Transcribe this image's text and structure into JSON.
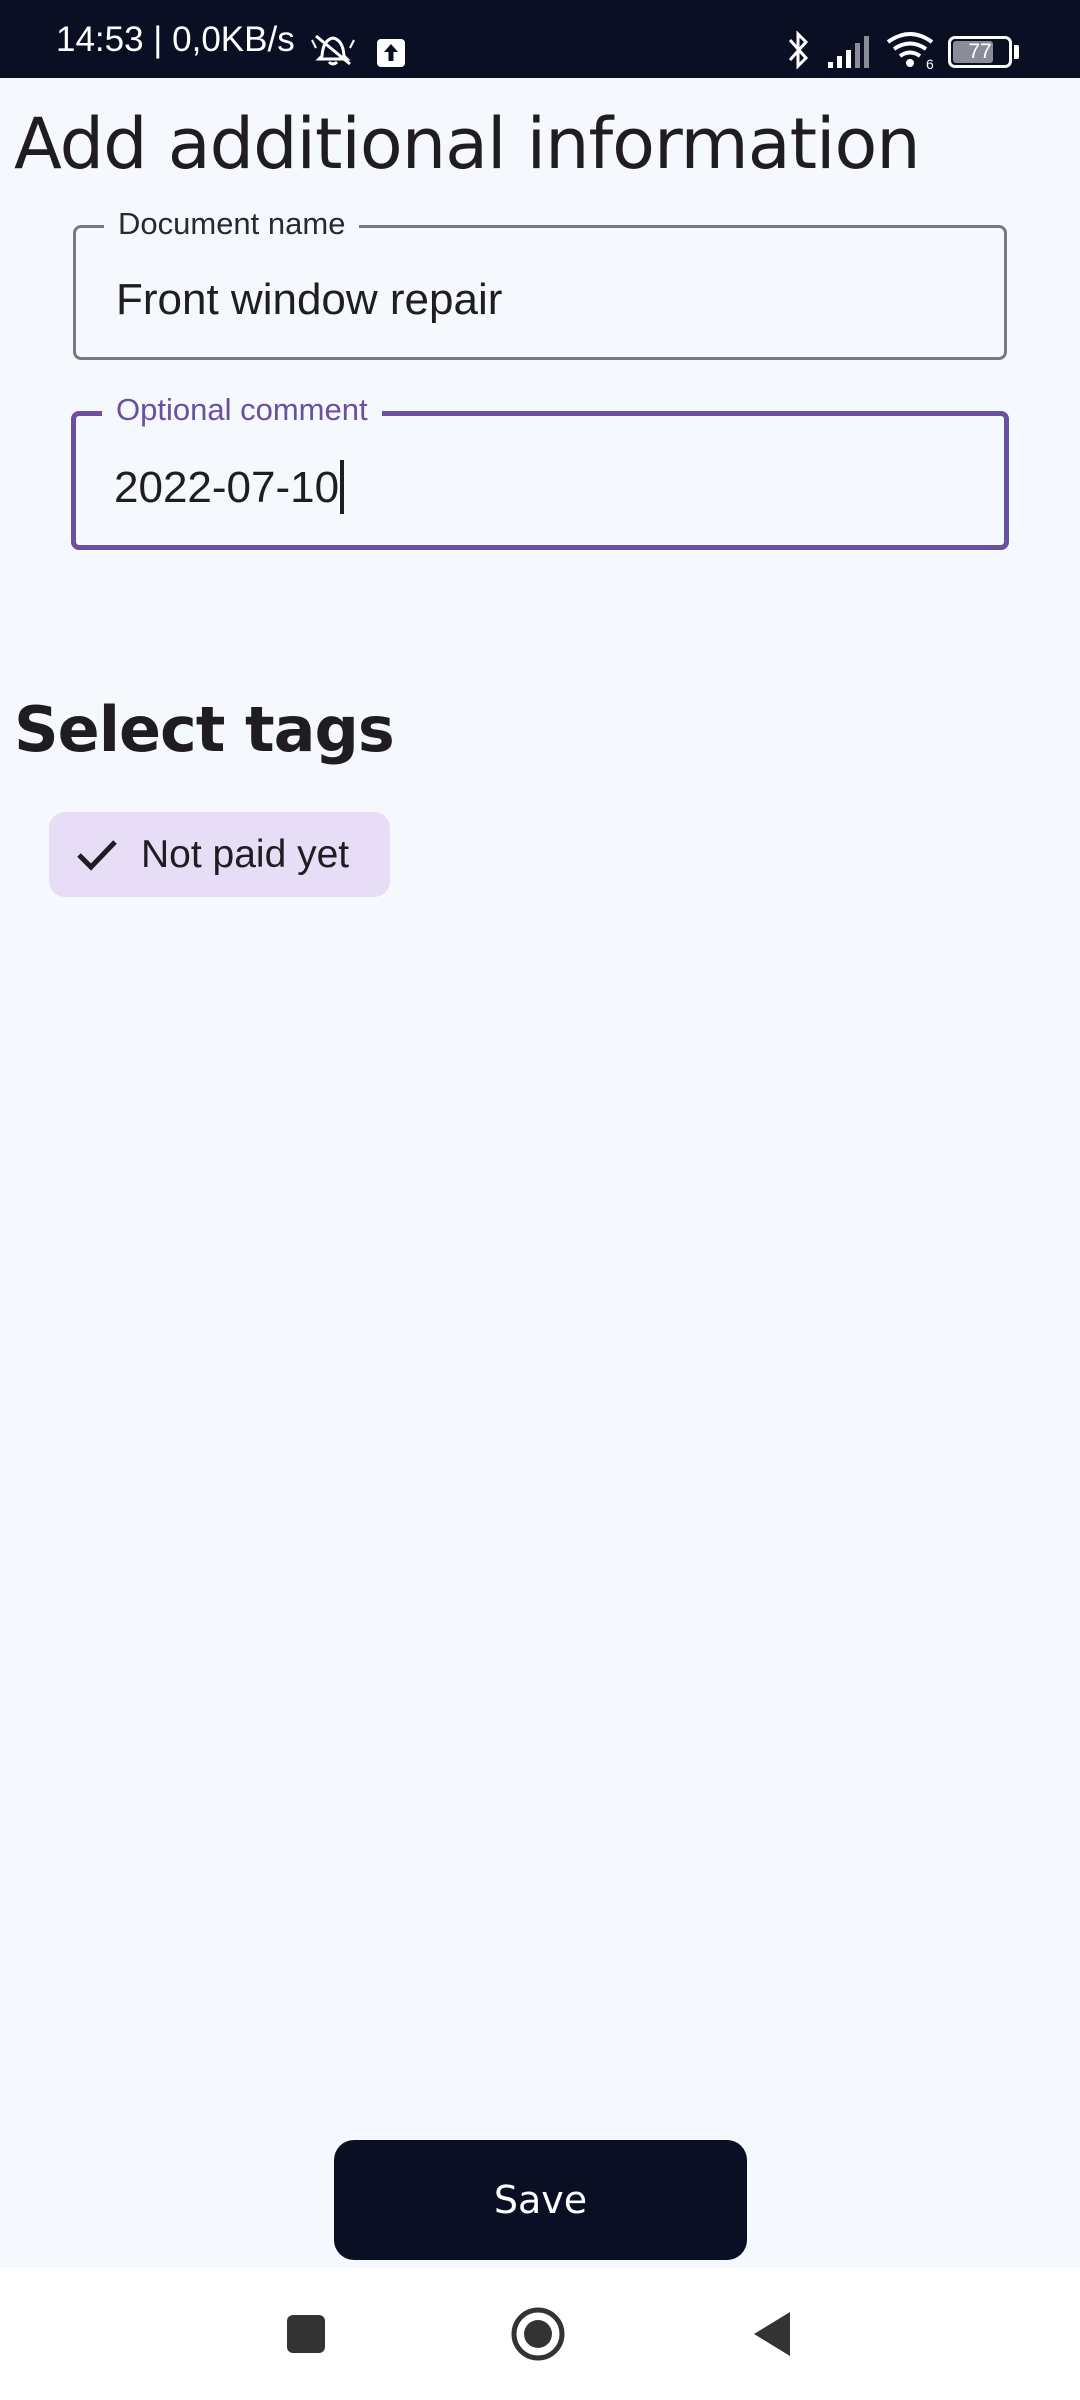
{
  "status_bar": {
    "time_speed": "14:53 | 0,0KB/s",
    "battery_level": "77",
    "signal_label": "6",
    "icons": [
      "alarm-off-icon",
      "upload-icon",
      "bluetooth-icon",
      "signal-icon",
      "wifi-icon",
      "battery-icon"
    ]
  },
  "page": {
    "title": "Add additional information"
  },
  "form": {
    "document_name": {
      "label": "Document name",
      "value": "Front window repair"
    },
    "comment": {
      "label": "Optional comment",
      "value": "2022-07-10",
      "focused": true
    }
  },
  "tags": {
    "section_title": "Select tags",
    "items": [
      {
        "label": "Not paid yet",
        "selected": true,
        "icon": "check-icon"
      }
    ]
  },
  "actions": {
    "save_label": "Save"
  },
  "nav_bar": {
    "icons": [
      "recents-icon",
      "home-icon",
      "back-icon"
    ]
  },
  "colors": {
    "status_bar_bg": "#0b0f24",
    "page_bg": "#f5f8fc",
    "accent": "#6b4fa0",
    "chip_bg": "#e7ddf6",
    "button_bg": "#0b0f24",
    "text": "#1f1c22"
  }
}
